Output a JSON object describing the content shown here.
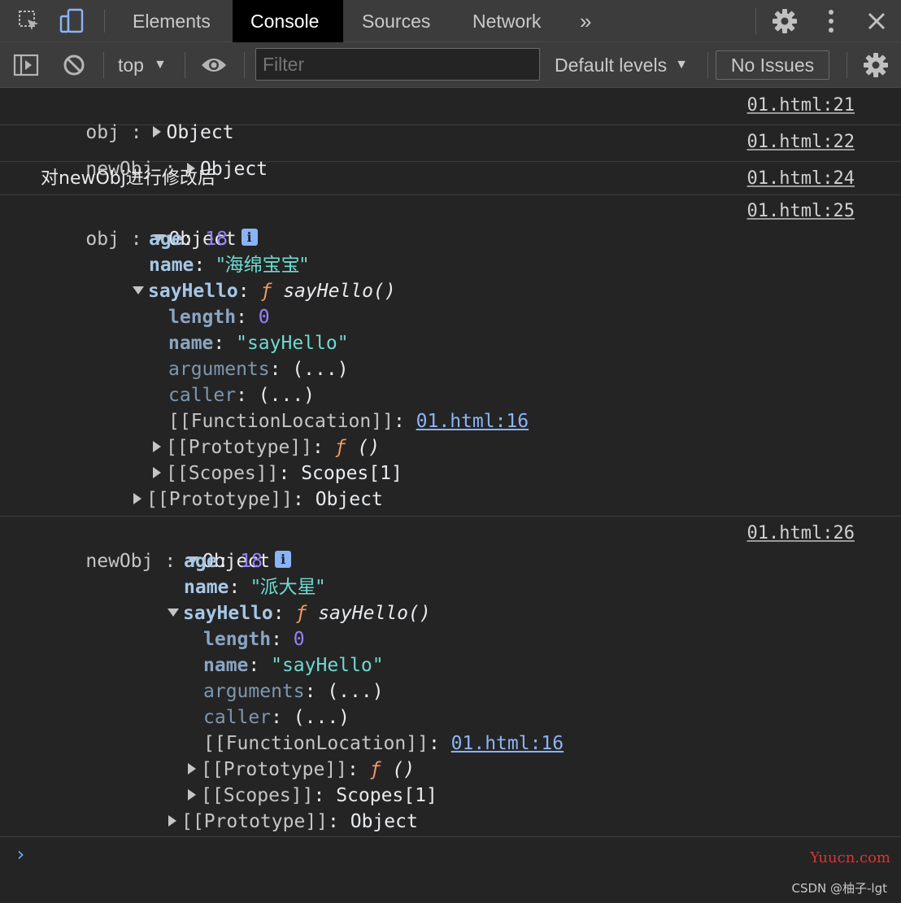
{
  "tabs": {
    "elements": "Elements",
    "console": "Console",
    "sources": "Sources",
    "network": "Network",
    "more": "»"
  },
  "toolbar": {
    "context": "top",
    "filter_placeholder": "Filter",
    "levels": "Default levels",
    "issues": "No Issues"
  },
  "messages": [
    {
      "label": "obj : ",
      "summary": "Object",
      "source": "01.html:21"
    },
    {
      "label": "newObj : ",
      "summary": "Object",
      "source": "01.html:22"
    },
    {
      "text": "对newObj进行修改后",
      "source": "01.html:24"
    },
    {
      "label": "obj : ",
      "summary": "Object",
      "source": "01.html:25",
      "age_key": "age",
      "age_value": "18",
      "name_key": "name",
      "name_value": "\"海绵宝宝\"",
      "fn_key": "sayHello",
      "fn_marker": "ƒ",
      "fn_sig": "sayHello()",
      "length_key": "length",
      "length_value": "0",
      "fname_key": "name",
      "fname_value": "\"sayHello\"",
      "arguments_key": "arguments",
      "arguments_value": "(...)",
      "caller_key": "caller",
      "caller_value": "(...)",
      "loc_key": "[[FunctionLocation]]",
      "loc_value": "01.html:16",
      "fproto_key": "[[Prototype]]",
      "fproto_value": "()",
      "scopes_key": "[[Scopes]]",
      "scopes_value": "Scopes[1]",
      "proto_key": "[[Prototype]]",
      "proto_value": "Object"
    },
    {
      "label": "newObj : ",
      "summary": "Object",
      "source": "01.html:26",
      "age_key": "age",
      "age_value": "18",
      "name_key": "name",
      "name_value": "\"派大星\"",
      "fn_key": "sayHello",
      "fn_marker": "ƒ",
      "fn_sig": "sayHello()",
      "length_key": "length",
      "length_value": "0",
      "fname_key": "name",
      "fname_value": "\"sayHello\"",
      "arguments_key": "arguments",
      "arguments_value": "(...)",
      "caller_key": "caller",
      "caller_value": "(...)",
      "loc_key": "[[FunctionLocation]]",
      "loc_value": "01.html:16",
      "fproto_key": "[[Prototype]]",
      "fproto_value": "()",
      "scopes_key": "[[Scopes]]",
      "scopes_value": "Scopes[1]",
      "proto_key": "[[Prototype]]",
      "proto_value": "Object"
    }
  ],
  "prompt": "›",
  "watermark": {
    "site": "Yuucn.com",
    "credit": "CSDN @柚子-lgt"
  },
  "colors": {
    "panel": "#3c3c3c",
    "background": "#242424",
    "link": "#8ab4f8",
    "number": "#9980ff",
    "function": "#f29766"
  }
}
